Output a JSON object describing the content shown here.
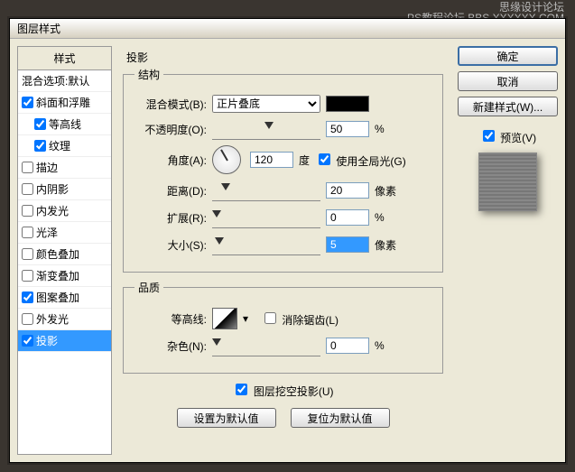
{
  "watermark": {
    "l1": "思缘设计论坛",
    "l2": "BBS.XXXXXX.COM",
    "tag": "PS教程论坛"
  },
  "title": "图层样式",
  "styles": {
    "header": "样式",
    "items": [
      {
        "label": "混合选项:默认",
        "cb": false,
        "sub": false,
        "checked": false
      },
      {
        "label": "斜面和浮雕",
        "cb": true,
        "sub": false,
        "checked": true
      },
      {
        "label": "等高线",
        "cb": true,
        "sub": true,
        "checked": true
      },
      {
        "label": "纹理",
        "cb": true,
        "sub": true,
        "checked": true
      },
      {
        "label": "描边",
        "cb": true,
        "sub": false,
        "checked": false
      },
      {
        "label": "内阴影",
        "cb": true,
        "sub": false,
        "checked": false
      },
      {
        "label": "内发光",
        "cb": true,
        "sub": false,
        "checked": false
      },
      {
        "label": "光泽",
        "cb": true,
        "sub": false,
        "checked": false
      },
      {
        "label": "颜色叠加",
        "cb": true,
        "sub": false,
        "checked": false
      },
      {
        "label": "渐变叠加",
        "cb": true,
        "sub": false,
        "checked": false
      },
      {
        "label": "图案叠加",
        "cb": true,
        "sub": false,
        "checked": true
      },
      {
        "label": "外发光",
        "cb": true,
        "sub": false,
        "checked": false
      },
      {
        "label": "投影",
        "cb": true,
        "sub": false,
        "checked": true,
        "selected": true
      }
    ]
  },
  "panel": {
    "title": "投影",
    "struct": {
      "legend": "结构",
      "blend_label": "混合模式(B):",
      "blend_value": "正片叠底",
      "opacity_label": "不透明度(O):",
      "opacity_val": "50",
      "opacity_unit": "%",
      "angle_label": "角度(A):",
      "angle_val": "120",
      "angle_unit": "度",
      "global_label": "使用全局光(G)",
      "dist_label": "距离(D):",
      "dist_val": "20",
      "dist_unit": "像素",
      "spread_label": "扩展(R):",
      "spread_val": "0",
      "spread_unit": "%",
      "size_label": "大小(S):",
      "size_val": "5",
      "size_unit": "像素"
    },
    "quality": {
      "legend": "品质",
      "contour_label": "等高线:",
      "aa_label": "消除锯齿(L)",
      "noise_label": "杂色(N):",
      "noise_val": "0",
      "noise_unit": "%"
    },
    "knockout_label": "图层挖空投影(U)",
    "set_default": "设置为默认值",
    "reset_default": "复位为默认值"
  },
  "right": {
    "ok": "确定",
    "cancel": "取消",
    "new_style": "新建样式(W)...",
    "preview": "预览(V)"
  }
}
